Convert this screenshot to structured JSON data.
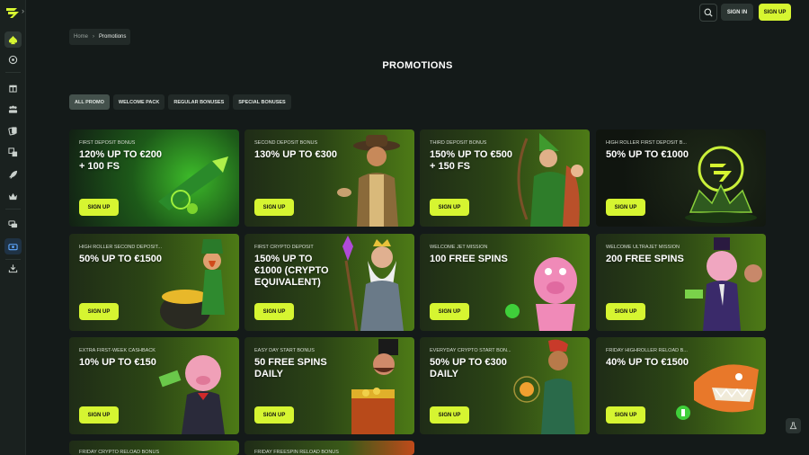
{
  "header": {
    "signin_label": "SIGN IN",
    "signup_label": "SIGN UP"
  },
  "sidebar": {
    "items": [
      {
        "name": "sidebar-item-casino-icon",
        "icon": "spade-icon"
      },
      {
        "name": "sidebar-item-sports-icon",
        "icon": "ball-icon"
      },
      {
        "name": "sidebar-item-promotions",
        "icon": "gift-icon"
      },
      {
        "name": "sidebar-item-live",
        "icon": "people-icon"
      },
      {
        "name": "sidebar-item-cards",
        "icon": "cards-icon"
      },
      {
        "name": "sidebar-item-exchange",
        "icon": "exchange-icon"
      },
      {
        "name": "sidebar-item-jet",
        "icon": "rocket-icon"
      },
      {
        "name": "sidebar-item-vip",
        "icon": "crown-icon"
      },
      {
        "name": "sidebar-item-chat",
        "icon": "chat-icon"
      },
      {
        "name": "sidebar-item-wallet",
        "icon": "wallet-icon"
      },
      {
        "name": "sidebar-item-download",
        "icon": "download-icon"
      }
    ]
  },
  "breadcrumb": {
    "home": "Home",
    "separator": "›",
    "current": "Promotions"
  },
  "page": {
    "title": "PROMOTIONS"
  },
  "tabs": [
    {
      "label": "ALL PROMO",
      "active": true
    },
    {
      "label": "WELCOME PACK",
      "active": false
    },
    {
      "label": "REGULAR BONUSES",
      "active": false
    },
    {
      "label": "SPECIAL BONUSES",
      "active": false
    }
  ],
  "cards": [
    {
      "kicker": "FIRST DEPOSIT BONUS",
      "headline": "120% UP TO €200 + 100 FS",
      "cta": "SIGN UP",
      "art": "rocket-art"
    },
    {
      "kicker": "SECOND DEPOSIT BONUS",
      "headline": "130% UP TO €300",
      "cta": "SIGN UP",
      "art": "explorer-art"
    },
    {
      "kicker": "THIRD DEPOSIT BONUS",
      "headline": "150% UP TO €500 + 150 FS",
      "cta": "SIGN UP",
      "art": "archer-art"
    },
    {
      "kicker": "HIGH ROLLER FIRST DEPOSIT B...",
      "headline": "50% UP TO €1000",
      "cta": "SIGN UP",
      "art": "logo-crown-art"
    },
    {
      "kicker": "HIGH ROLLER SECOND DEPOSIT...",
      "headline": "50% UP TO €1500",
      "cta": "SIGN UP",
      "art": "leprechaun-art"
    },
    {
      "kicker": "FIRST CRYPTO DEPOSIT",
      "headline": "150% UP TO €1000 (CRYPTO EQUIVALENT)",
      "cta": "SIGN UP",
      "art": "wizard-art"
    },
    {
      "kicker": "WELCOME JET MISSION",
      "headline": "100 FREE SPINS",
      "cta": "SIGN UP",
      "art": "pig-art"
    },
    {
      "kicker": "WELCOME ULTRAJET MISSION",
      "headline": "200 FREE SPINS",
      "cta": "SIGN UP",
      "art": "pig-suit-art"
    },
    {
      "kicker": "EXTRA FIRST-WEEK CASHBACK",
      "headline": "10% UP TO €150",
      "cta": "SIGN UP",
      "art": "pig-cash-art"
    },
    {
      "kicker": "EASY DAY START BONUS",
      "headline": "50 FREE SPINS DAILY",
      "cta": "SIGN UP",
      "art": "treasure-art"
    },
    {
      "kicker": "EVERYDAY CRYPTO START BON...",
      "headline": "50% UP TO €300 DAILY",
      "cta": "SIGN UP",
      "art": "genie-art"
    },
    {
      "kicker": "FRIDAY HIGHROLLER RELOAD B...",
      "headline": "40% UP TO €1500",
      "cta": "SIGN UP",
      "art": "shark-art"
    },
    {
      "kicker": "FRIDAY CRYPTO RELOAD BONUS",
      "headline": "",
      "cta": "",
      "art": ""
    },
    {
      "kicker": "FRIDAY FREESPIN RELOAD BONUS",
      "headline": "",
      "cta": "",
      "art": ""
    }
  ],
  "colors": {
    "accent": "#d6f531",
    "background": "#141a19",
    "panel": "#222a28"
  }
}
